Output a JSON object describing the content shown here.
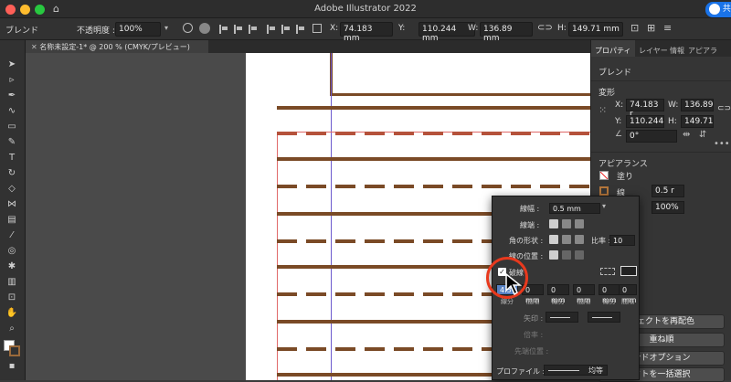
{
  "app": {
    "title": "Adobe Illustrator 2022",
    "share_label": "共"
  },
  "control_bar": {
    "selection": "ブレンド",
    "opacity_label": "不透明度 :",
    "opacity_value": "100%",
    "x_label": "X:",
    "x_value": "74.183 mm",
    "y_label": "Y:",
    "y_value": "110.244 mm",
    "w_label": "W:",
    "w_value": "136.89 mm",
    "h_label": "H:",
    "h_value": "149.71 mm"
  },
  "document_tab": {
    "label": "名称未設定-1* @ 200 % (CMYK/プレビュー)"
  },
  "toolbar": {
    "tools": [
      "selection-tool",
      "direct-select-tool",
      "pen-tool",
      "curvature-tool",
      "type-tool",
      "rectangle-tool",
      "paintbrush-tool",
      "pencil-tool",
      "eraser-tool",
      "rotate-tool",
      "scale-tool",
      "width-tool",
      "shape-builder-tool",
      "gradient-tool",
      "eyedropper-tool",
      "blend-tool",
      "symbol-tool",
      "graph-tool",
      "artboard-tool",
      "slice-tool",
      "hand-tool",
      "zoom-tool",
      "fill-stroke",
      "color-mode",
      "draw-mode"
    ]
  },
  "properties_panel": {
    "tabs": [
      "プロパティ",
      "レイヤー",
      "情報",
      "アピアラ"
    ],
    "object_type": "ブレンド",
    "transform_title": "変形",
    "x_label": "X:",
    "x_value": "74.183 r",
    "y_label": "Y:",
    "y_value": "110.244",
    "w_label": "W:",
    "w_value": "136.89",
    "h_label": "H:",
    "h_value": "149.71",
    "angle_value": "0°",
    "appearance_title": "アピアランス",
    "fill_label": "塗り",
    "stroke_label": "線",
    "stroke_weight": "0.5 r",
    "opacity_value": "100%",
    "recolor_button": "ジェクトを再配色",
    "stacking_button": "重ね順",
    "blend_options_button": "ンドオプション",
    "select_same_button": "クトを一括選択"
  },
  "stroke_popup": {
    "weight_label": "線幅 :",
    "weight_value": "0.5 mm",
    "cap_label": "線端 :",
    "corner_label": "角の形状 :",
    "limit_label": "比率 :",
    "limit_value": "10",
    "align_label": "線の位置 :",
    "dashed_label": "破線",
    "dash_first_value": "4.3",
    "dash_fields": [
      "0 mm",
      "0 mm",
      "0 mm",
      "0 mm",
      "0 mm"
    ],
    "gap_labels": [
      "間隔",
      "線分",
      "間隔",
      "線分",
      "間隔"
    ],
    "dash_first_label": "線分",
    "arrow_label": "矢印 :",
    "scale_label": "倍率 :",
    "arrow_pos_label": "先端位置 :",
    "profile_label": "プロファイル :",
    "profile_value": "均等"
  },
  "colors": {
    "accent_red": "#e8391d",
    "rule_brown": "#7a4a26",
    "dash_red": "#b5523b",
    "guide_purple": "#6c5acd"
  }
}
